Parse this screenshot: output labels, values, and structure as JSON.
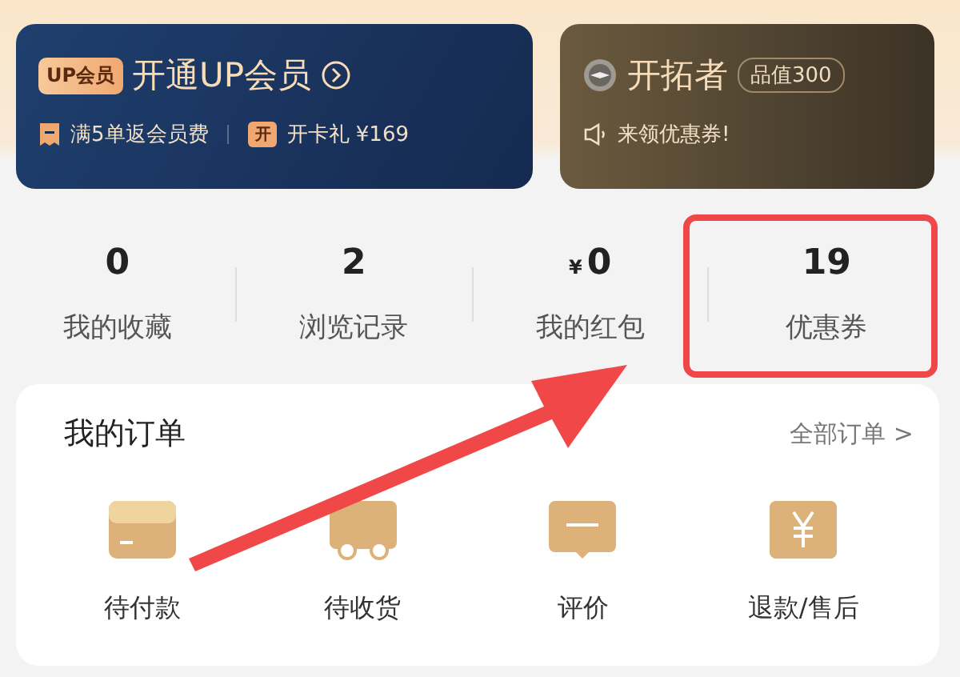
{
  "vip_card": {
    "badge": "UP会员",
    "title": "开通UP会员",
    "perks": [
      {
        "kind": "receipt",
        "text": "满5单返会员费"
      },
      {
        "kind": "tag",
        "tag": "开",
        "text": "开卡礼 ¥169"
      }
    ]
  },
  "level_card": {
    "title": "开拓者",
    "value_badge": "品值300",
    "notice": "来领优惠券!"
  },
  "stats": [
    {
      "value": "0",
      "label": "我的收藏",
      "highlighted": false
    },
    {
      "value": "2",
      "label": "浏览记录",
      "highlighted": false
    },
    {
      "prefix": "¥",
      "value": "0",
      "label": "我的红包",
      "highlighted": false
    },
    {
      "value": "19",
      "label": "优惠券",
      "highlighted": true
    }
  ],
  "orders": {
    "title": "我的订单",
    "all_link": "全部订单 >",
    "items": [
      {
        "kind": "wallet",
        "label": "待付款"
      },
      {
        "kind": "truck",
        "label": "待收货"
      },
      {
        "kind": "comment",
        "label": "评价"
      },
      {
        "kind": "refund",
        "label": "退款/售后"
      }
    ]
  }
}
